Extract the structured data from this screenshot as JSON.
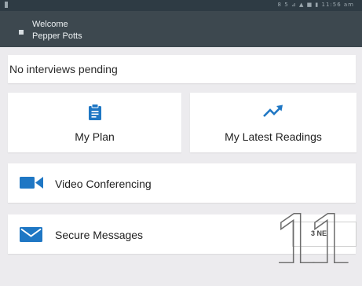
{
  "status_bar": {
    "right_text": "8 5 ⊿ ▲ ■ ▮ 11:56 am"
  },
  "header": {
    "welcome_label": "Welcome",
    "user_name": "Pepper Potts"
  },
  "interviews": {
    "status_text": "No interviews pending"
  },
  "tiles": [
    {
      "label": "My Plan",
      "icon": "clipboard-icon"
    },
    {
      "label": "My Latest Readings",
      "icon": "trending-up-icon"
    }
  ],
  "rows": [
    {
      "label": "Video Conferencing",
      "icon": "video-camera-icon"
    },
    {
      "label": "Secure Messages",
      "icon": "envelope-icon",
      "count_text": "3 NE"
    }
  ],
  "callout": {
    "number": "11"
  },
  "colors": {
    "accent": "#1f77c4",
    "app_bar": "#3d484f",
    "status_bar": "#2e3b44",
    "background": "#ecebee"
  }
}
